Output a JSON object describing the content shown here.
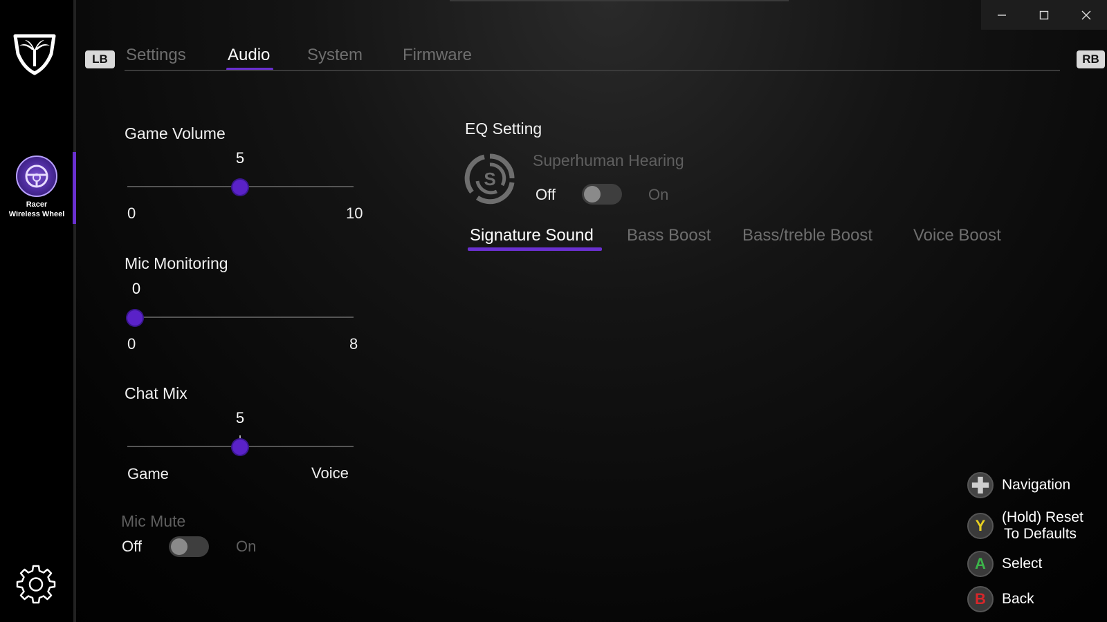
{
  "window": {
    "controls": [
      "minimize",
      "maximize",
      "close"
    ]
  },
  "sidebar": {
    "device_name_line1": "Racer",
    "device_name_line2": "Wireless Wheel"
  },
  "tabs": {
    "lb": "LB",
    "rb": "RB",
    "items": [
      {
        "label": "Settings"
      },
      {
        "label": "Audio",
        "active": true
      },
      {
        "label": "System"
      },
      {
        "label": "Firmware"
      }
    ]
  },
  "game_volume": {
    "label": "Game Volume",
    "value": "5",
    "min": "0",
    "max": "10"
  },
  "mic_monitoring": {
    "label": "Mic Monitoring",
    "value": "0",
    "min": "0",
    "max": "8"
  },
  "chat_mix": {
    "label": "Chat Mix",
    "value": "5",
    "min_label": "Game",
    "max_label": "Voice",
    "range_max": 10
  },
  "mic_mute": {
    "label": "Mic Mute",
    "off": "Off",
    "on": "On",
    "state": "off"
  },
  "eq": {
    "title": "EQ Setting",
    "superhuman": {
      "label": "Superhuman Hearing",
      "off": "Off",
      "on": "On",
      "state": "off"
    },
    "presets": [
      {
        "label": "Signature Sound",
        "active": true
      },
      {
        "label": "Bass Boost"
      },
      {
        "label": "Bass/treble Boost"
      },
      {
        "label": "Voice Boost"
      }
    ]
  },
  "legend": {
    "navigation": "Navigation",
    "reset_line1": "(Hold) Reset",
    "reset_line2": "To Defaults",
    "select": "Select",
    "back": "Back",
    "y": "Y",
    "a": "A",
    "b": "B"
  },
  "colors": {
    "accent": "#6a30d0",
    "y_button": "#e8d020",
    "a_button": "#3cb44a",
    "b_button": "#d8262a"
  }
}
